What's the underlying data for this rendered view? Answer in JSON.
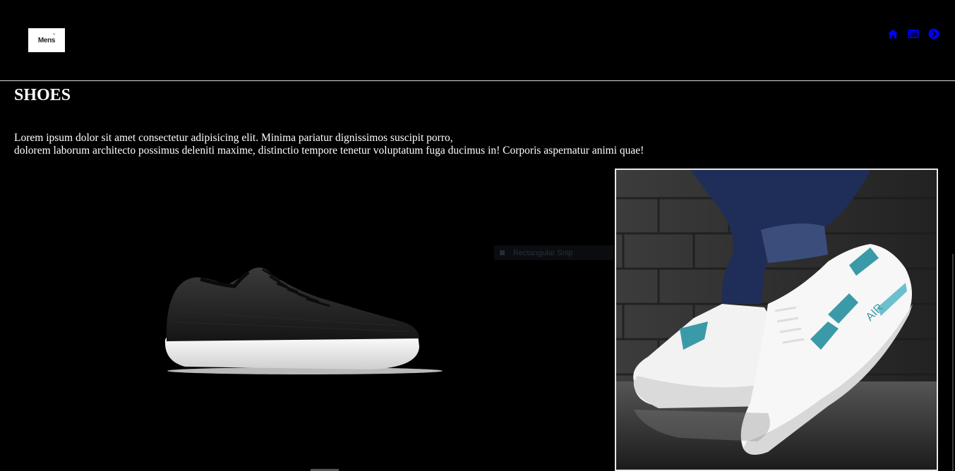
{
  "header": {
    "logo_text": "Mens",
    "icons": [
      "home-icon",
      "list-icon",
      "arrow-circle-right-icon"
    ],
    "icon_color": "#0000ff"
  },
  "main": {
    "title": "SHOES",
    "description_line1": "Lorem ipsum dolor sit amet consectetur adipisicing elit. Minima pariatur dignissimos suscipit porro,",
    "description_line2": "dolorem laborum architecto possimus deleniti maxime, distinctio tempore tenetur voluptatum fuga ducimus in! Corporis aspernatur animi quae!",
    "ghost_label": "Rectangular Snip"
  },
  "colors": {
    "background": "#000000",
    "text": "#ffffff",
    "accent": "#0000ff",
    "sneaker_accent": "#3a9aa8"
  }
}
